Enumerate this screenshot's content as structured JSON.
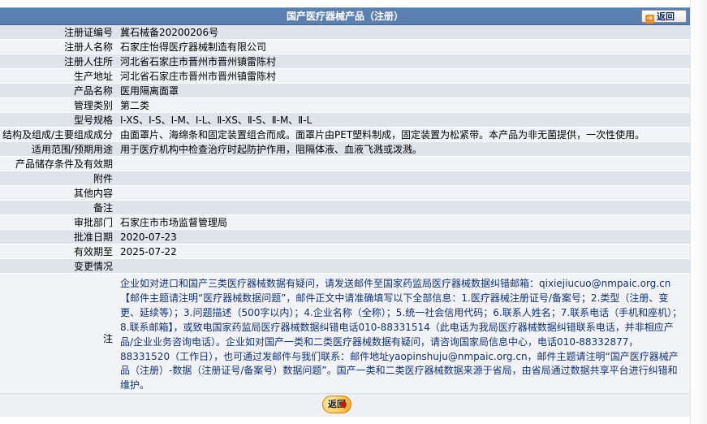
{
  "header": {
    "title": "国产医疗器械产品（注册）",
    "back_label": "返回"
  },
  "rows": [
    {
      "label": "注册证编号",
      "value": "冀石械备20200206号"
    },
    {
      "label": "注册人名称",
      "value": "石家庄怡得医疗器械制造有限公司"
    },
    {
      "label": "注册人住所",
      "value": "河北省石家庄市晋州市晋州镇雷陈村"
    },
    {
      "label": "生产地址",
      "value": "河北省石家庄市晋州市晋州镇雷陈村"
    },
    {
      "label": "产品名称",
      "value": "医用隔离面罩"
    },
    {
      "label": "管理类别",
      "value": "第二类"
    },
    {
      "label": "型号规格",
      "value": "Ⅰ-XS、Ⅰ-S、Ⅰ-M、Ⅰ-L、Ⅱ-XS、Ⅱ-S、Ⅱ-M、Ⅱ-L"
    },
    {
      "label": "结构及组成/主要组成成分",
      "value": "由面罩片、海绵条和固定装置组合而成。面罩片由PET塑料制成，固定装置为松紧带。本产品为非无菌提供，一次性使用。"
    },
    {
      "label": "适用范围/预期用途",
      "value": "用于医疗机构中检查治疗时起防护作用，阻隔体液、血液飞溅或泼溅。"
    },
    {
      "label": "产品储存条件及有效期",
      "value": ""
    },
    {
      "label": "附件",
      "value": ""
    },
    {
      "label": "其他内容",
      "value": ""
    },
    {
      "label": "备注",
      "value": ""
    },
    {
      "label": "审批部门",
      "value": "石家庄市市场监督管理局"
    },
    {
      "label": "批准日期",
      "value": "2020-07-23"
    },
    {
      "label": "有效期至",
      "value": "2025-07-22"
    },
    {
      "label": "变更情况",
      "value": ""
    }
  ],
  "note": {
    "label": "注",
    "text": "企业如对进口和国产三类医疗器械数据有疑问，请发送邮件至国家药监局医疗器械数据纠错邮箱：qixiejiucuo@nmpaic.org.cn【邮件主题请注明“医疗器械数据问题”，邮件正文中请准确填写以下全部信息：1.医疗器械注册证号/备案号；2.类型（注册、变更、延续等）；3.问题描述（500字以内）；4.企业名称（全称）；5.统一社会信用代码；6.联系人姓名；7.联系电话（手机和座机）；8.联系邮箱】，或致电国家药监局医疗器械数据纠错电话010-88331514（此电话为我局医疗器械数据纠错联系电话，并非相应产品/企业业务咨询电话）。企业如对国产一类和二类医疗器械数据有疑问，请咨询国家局信息中心，电话010-88332877，88331520（工作日），也可通过发邮件与我们联系：邮件地址yaopinshuju@nmpaic.org.cn，邮件主题请注明“国产医疗器械产品（注册）-数据（注册证号/备案号）数据问题”。国产一类和二类医疗器械数据来源于省局，由省局通过数据共享平台进行纠错和维护。"
  },
  "footer": {
    "back_label": "返回"
  }
}
